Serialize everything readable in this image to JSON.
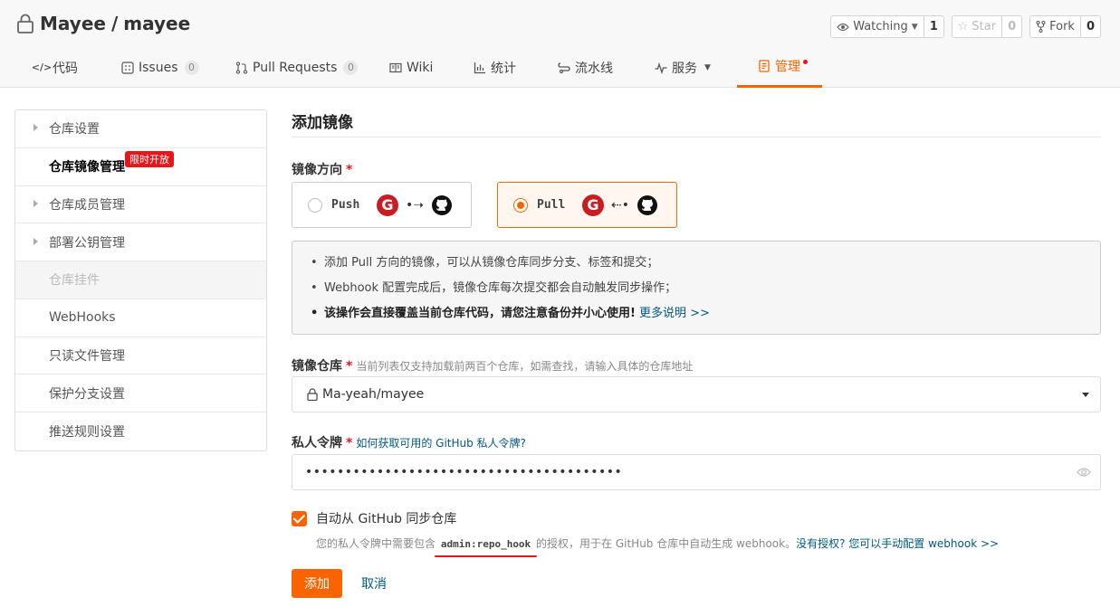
{
  "repo": {
    "owner": "Mayee",
    "separator": "/",
    "name": "mayee"
  },
  "actions": {
    "watch": {
      "label": "Watching",
      "count": "1"
    },
    "star": {
      "label": "Star",
      "count": "0"
    },
    "fork": {
      "label": "Fork",
      "count": "0"
    }
  },
  "tabs": [
    {
      "label": "代码",
      "icon": "code-icon"
    },
    {
      "label": "Issues",
      "icon": "issues-icon",
      "badge": "0"
    },
    {
      "label": "Pull Requests",
      "icon": "pull-request-icon",
      "badge": "0"
    },
    {
      "label": "Wiki",
      "icon": "book-icon"
    },
    {
      "label": "统计",
      "icon": "bar-chart-icon"
    },
    {
      "label": "流水线",
      "icon": "pipeline-icon"
    },
    {
      "label": "服务",
      "icon": "pulse-icon"
    },
    {
      "label": "管理",
      "icon": "settings-doc-icon"
    }
  ],
  "sidebar": {
    "items": [
      {
        "label": "仓库设置"
      },
      {
        "label": "仓库镜像管理",
        "tag": "限时开放"
      },
      {
        "label": "仓库成员管理"
      },
      {
        "label": "部署公钥管理"
      },
      {
        "label": "仓库挂件"
      },
      {
        "label": "WebHooks"
      },
      {
        "label": "只读文件管理"
      },
      {
        "label": "保护分支设置"
      },
      {
        "label": "推送规则设置"
      }
    ]
  },
  "form": {
    "title": "添加镜像",
    "direction": {
      "label": "镜像方向",
      "required": "*",
      "options": [
        {
          "label": "Push",
          "arrow": "•➝"
        },
        {
          "label": "Pull",
          "arrow": "⇠•"
        }
      ],
      "selected": "Pull"
    },
    "info": {
      "line1": "添加 Pull 方向的镜像，可以从镜像仓库同步分支、标签和提交；",
      "line2": "Webhook 配置完成后，镜像仓库每次提交都会自动触发同步操作；",
      "line3": "该操作会直接覆盖当前仓库代码，请您注意备份并小心使用!",
      "more": "更多说明 >>"
    },
    "repo_field": {
      "label": "镜像仓库",
      "required": "*",
      "hint": "当前列表仅支持加载前两百个仓库，如需查找，请输入具体的仓库地址",
      "value": "Ma-yeah/mayee"
    },
    "token_field": {
      "label": "私人令牌",
      "required": "*",
      "hint_link": "如何获取可用的 GitHub 私人令牌?",
      "value": "••••••••••••••••••••••••••••••••••••••••"
    },
    "auto_sync": {
      "label": "自动从 GitHub 同步仓库",
      "checked": true,
      "hint_prefix": "您的私人令牌中需要包含",
      "hint_code": "admin:repo_hook",
      "hint_mid": "的授权，用于在 GitHub 仓库中自动生成 webhook。",
      "hint_link": "没有授权? 您可以手动配置 webhook >>"
    },
    "submit_label": "添加",
    "cancel_label": "取消"
  }
}
